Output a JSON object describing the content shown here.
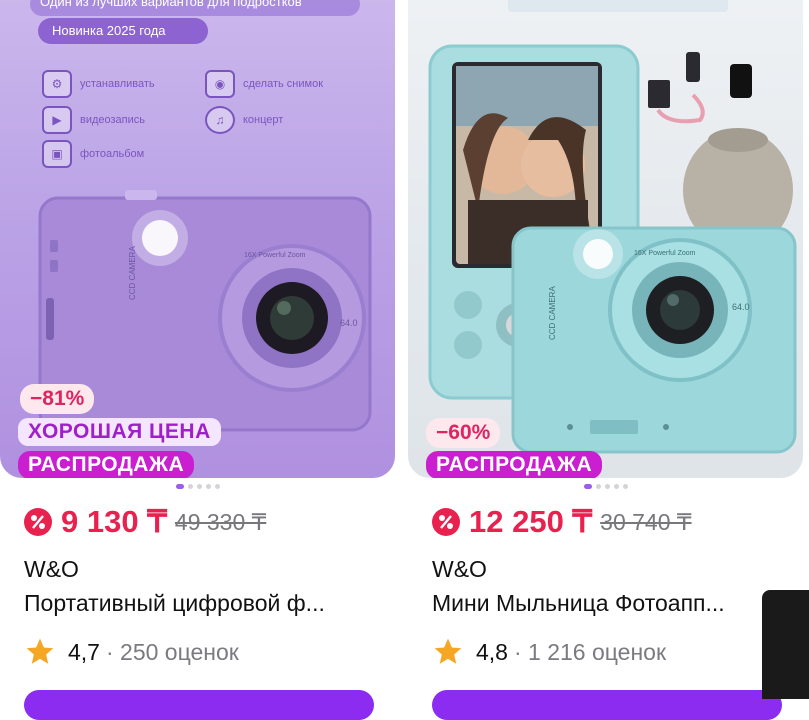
{
  "products": [
    {
      "promo_banner": "Один из лучших вариантов для подростков",
      "promo_new": "Новинка 2025 года",
      "features": [
        {
          "icon": "gear-icon",
          "label": "устанавливать"
        },
        {
          "icon": "camera-icon",
          "label": "сделать снимок"
        },
        {
          "icon": "video-icon",
          "label": "видеозапись"
        },
        {
          "icon": "music-icon",
          "label": "концерт"
        },
        {
          "icon": "album-icon",
          "label": "фотоальбом"
        }
      ],
      "camera_label": "CCD CAMERA",
      "lens_label": "16X Powerful Zoom",
      "mp_label": "64.0",
      "discount": "−81%",
      "good_price": "ХОРОШАЯ ЦЕНА",
      "sale": "РАСПРОДАЖА",
      "price": "9 130 ₸",
      "old_price": "49 330 ₸",
      "brand": "W&O",
      "title": "Портативный цифровой ф...",
      "rating": "4,7",
      "reviews": "· 250 оценок"
    },
    {
      "camera_label": "CCD CAMERA",
      "lens_label": "16X Powerful Zoom",
      "mp_label": "64.0",
      "discount": "−60%",
      "sale": "РАСПРОДАЖА",
      "price": "12 250 ₸",
      "old_price": "30 740 ₸",
      "brand": "W&O",
      "title": "Мини Мыльница Фотоапп...",
      "rating": "4,8",
      "reviews": "· 1 216 оценок"
    }
  ],
  "colors": {
    "price": "#e8214f",
    "sale_badge": "#c91fd0",
    "accent": "#8b2cf0",
    "star": "#f5a623"
  }
}
